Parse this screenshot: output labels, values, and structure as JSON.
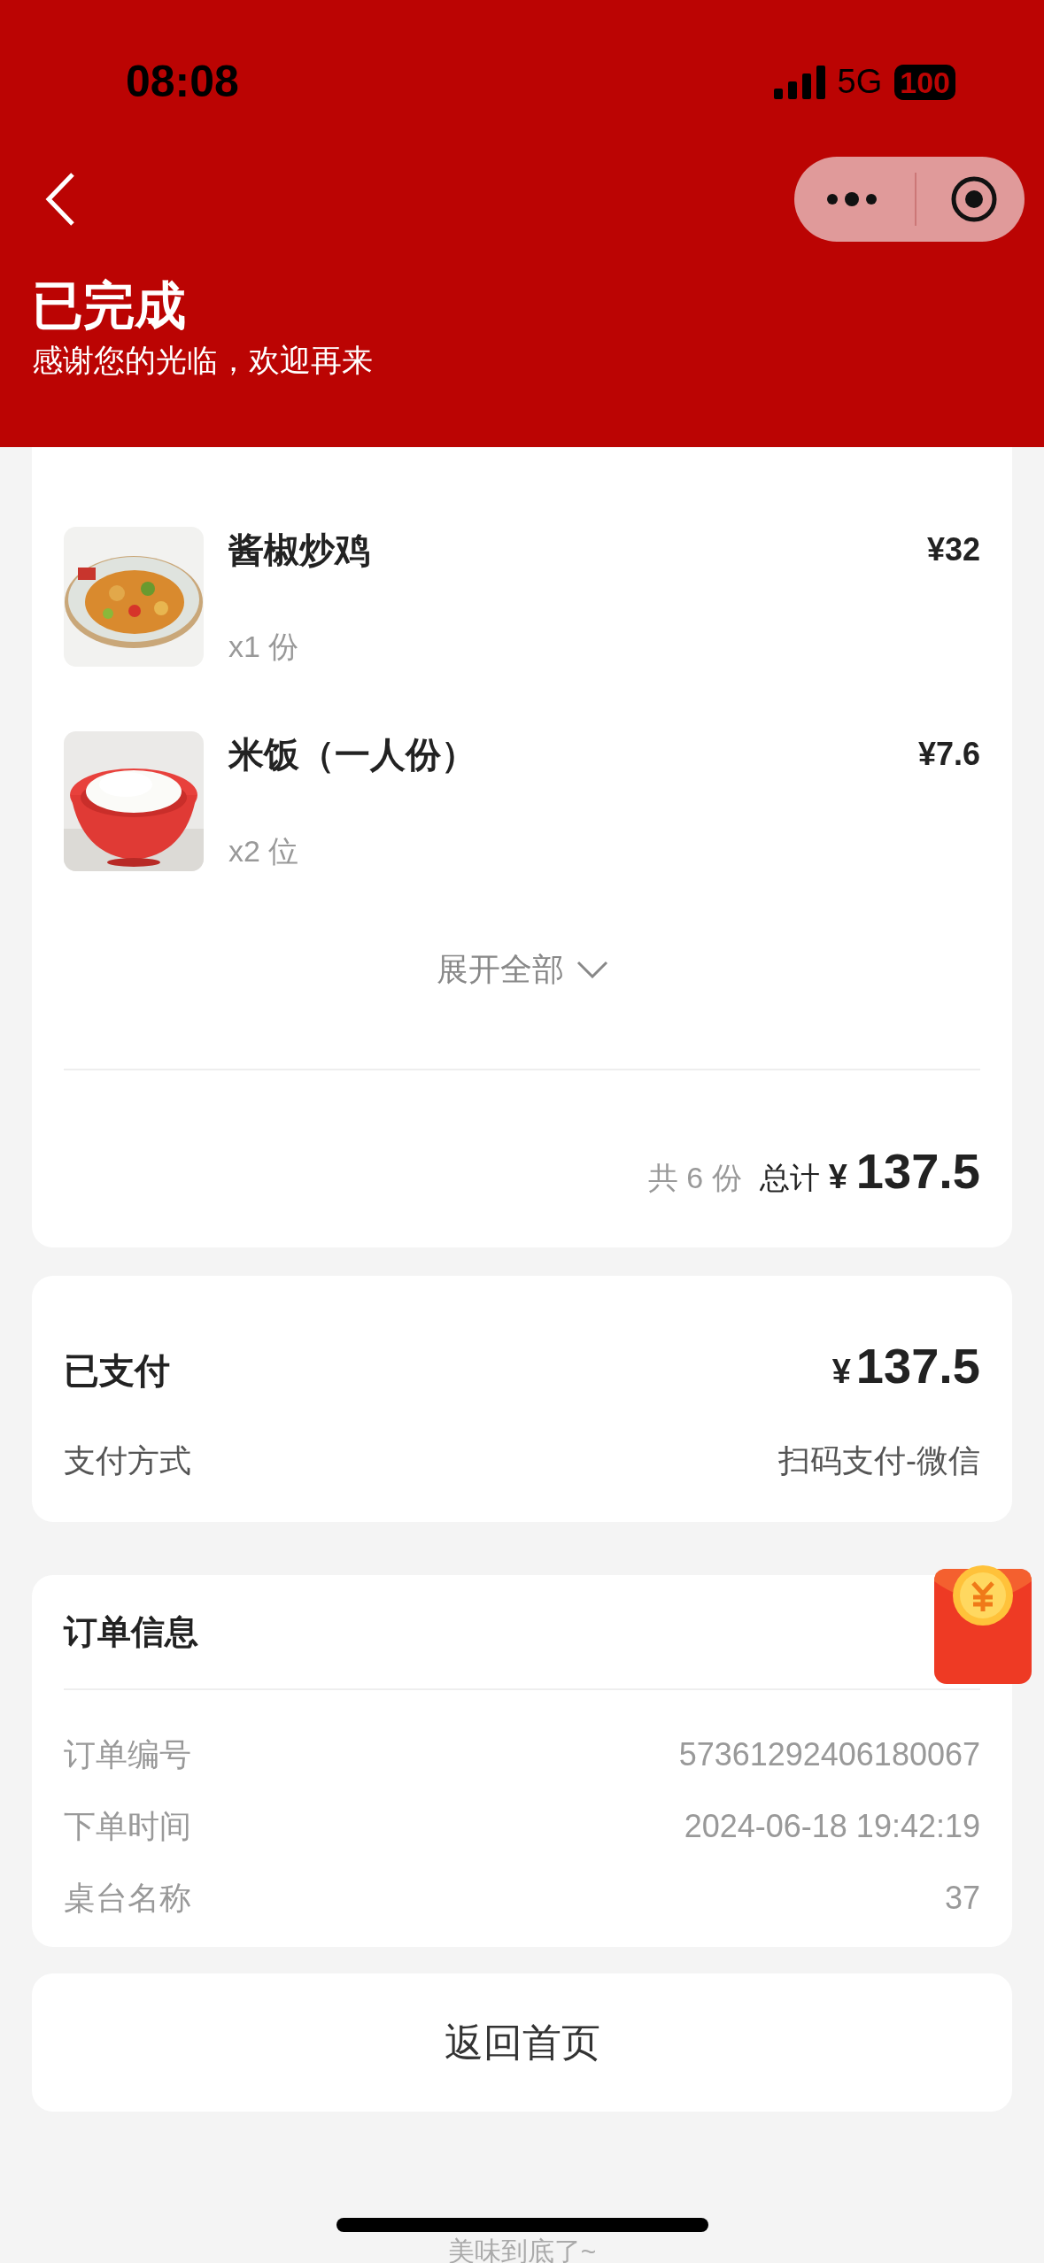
{
  "status_bar": {
    "time": "08:08",
    "network": "5G",
    "battery": "100"
  },
  "header": {
    "title": "已完成",
    "subtitle": "感谢您的光临，欢迎再来"
  },
  "items": [
    {
      "name": "酱椒炒鸡",
      "price": "¥32",
      "quantity": "x1 份"
    },
    {
      "name": "米饭（一人份）",
      "price": "¥7.6",
      "quantity": "x2 位"
    }
  ],
  "expand": {
    "label": "展开全部"
  },
  "summary": {
    "count": "共 6 份",
    "total_label": "总计",
    "currency": "¥",
    "total": "137.5"
  },
  "payment": {
    "status": "已支付",
    "currency": "¥",
    "amount": "137.5",
    "method_label": "支付方式",
    "method": "扫码支付-微信"
  },
  "order_info": {
    "title": "订单信息",
    "rows": [
      {
        "label": "订单编号",
        "value": "57361292406180067"
      },
      {
        "label": "下单时间",
        "value": "2024-06-18 19:42:19"
      },
      {
        "label": "桌台名称",
        "value": "37"
      }
    ]
  },
  "home_button": "返回首页",
  "footer": "美味到底了~"
}
